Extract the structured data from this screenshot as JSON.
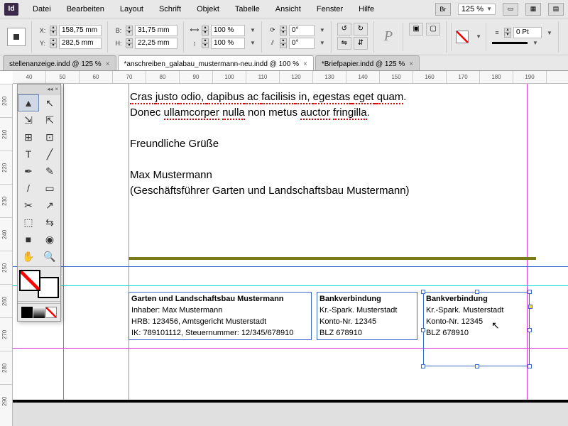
{
  "app": {
    "id_badge": "Id"
  },
  "menu": [
    "Datei",
    "Bearbeiten",
    "Layout",
    "Schrift",
    "Objekt",
    "Tabelle",
    "Ansicht",
    "Fenster",
    "Hilfe"
  ],
  "menu_right": {
    "br": "Br",
    "zoom": "125 %"
  },
  "coords": {
    "x_lbl": "X:",
    "x": "158,75 mm",
    "y_lbl": "Y:",
    "y": "282,5 mm",
    "b_lbl": "B:",
    "b": "31,75 mm",
    "h_lbl": "H:",
    "h": "22,25 mm"
  },
  "scale": {
    "sx": "100 %",
    "sy": "100 %"
  },
  "angles": {
    "rot": "0°",
    "shear": "0°"
  },
  "stroke": {
    "weight": "0 Pt"
  },
  "tabs": [
    {
      "label": "stellenanzeige.indd @ 125 %",
      "active": false
    },
    {
      "label": "*anschreiben_galabau_mustermann-neu.indd @ 100 %",
      "active": true
    },
    {
      "label": "*Briefpapier.indd @ 125 %",
      "active": false
    }
  ],
  "hruler": [
    "40",
    "50",
    "60",
    "70",
    "80",
    "90",
    "100",
    "110",
    "120",
    "130",
    "140",
    "150",
    "160",
    "170",
    "180",
    "190"
  ],
  "vruler": [
    "200",
    "210",
    "220",
    "230",
    "240",
    "250",
    "260",
    "270",
    "280",
    "290"
  ],
  "body": {
    "l1a": "Cras ",
    "l1b": "justo",
    "l1c": " odio, ",
    "l1d": "dapibus",
    "l1e": " ac ",
    "l1f": "facilisis",
    "l1g": " in, ",
    "l1h": "egestas",
    "l1i": " ",
    "l1j": "eget",
    "l1k": " ",
    "l1l": "quam",
    "l1m": ".",
    "l2a": "Donec ",
    "l2b": "ullamcorper",
    "l2c": " ",
    "l2d": "nulla",
    "l2e": " non metus ",
    "l2f": "auctor",
    "l2g": " ",
    "l2h": "fringilla",
    "l2i": ".",
    "l4": "Freundliche Grüße",
    "l6": "Max Mustermann",
    "l7": "(Geschäftsführer Garten und Landschaftsbau Mustermann)"
  },
  "footer1": {
    "l1": "Garten und Landschaftsbau Mustermann",
    "l2": "Inhaber: Max Mustermann",
    "l3": "HRB: 123456, Amtsgericht Musterstadt",
    "l4": "IK: 789101112, Steuernummer: 12/345/678910"
  },
  "footer2": {
    "l1": "Bankverbindung",
    "l2": "Kr.-Spark. Musterstadt",
    "l3": "Konto-Nr. 12345",
    "l4": "BLZ 678910"
  },
  "footer3": {
    "l1": "Bankverbindung",
    "l2": "Kr.-Spark. Musterstadt",
    "l3": "Konto-Nr. 12345",
    "l4": "BLZ 678910"
  },
  "tools": {
    "grid": [
      "▲",
      "↖",
      "⇲",
      "⇱",
      "⊞",
      "⊡",
      "T",
      "╱",
      "✒",
      "✎",
      "/",
      "▭",
      "✂",
      "↗",
      "⬚",
      "⇆",
      "■",
      "◉",
      "✋",
      "🔍"
    ]
  }
}
